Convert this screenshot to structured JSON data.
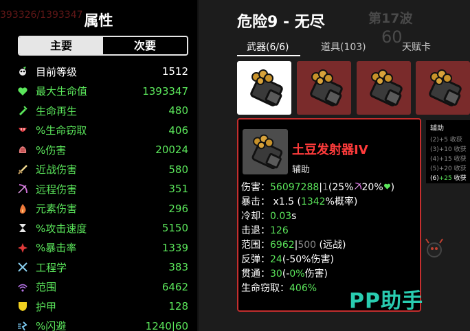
{
  "left": {
    "bg_ghost_text": "393326/1393347",
    "title": "属性",
    "tabs": {
      "primary": "主要",
      "secondary": "次要"
    },
    "stats": [
      {
        "icon": "level-icon",
        "label": "目前等级",
        "value": "1512",
        "label_color": "white"
      },
      {
        "icon": "heart-icon",
        "label": "最大生命值",
        "value": "1393347",
        "label_color": "green"
      },
      {
        "icon": "regen-icon",
        "label": "生命再生",
        "value": "480",
        "label_color": "green"
      },
      {
        "icon": "lifesteal-icon",
        "label": "%生命窃取",
        "value": "406",
        "label_color": "green"
      },
      {
        "icon": "damage-icon",
        "label": "%伤害",
        "value": "20024",
        "label_color": "green"
      },
      {
        "icon": "sword-icon",
        "label": "近战伤害",
        "value": "580",
        "label_color": "green"
      },
      {
        "icon": "bow-icon",
        "label": "远程伤害",
        "value": "351",
        "label_color": "green"
      },
      {
        "icon": "flame-icon",
        "label": "元素伤害",
        "value": "296",
        "label_color": "green"
      },
      {
        "icon": "hourglass-icon",
        "label": "%攻击速度",
        "value": "5150",
        "label_color": "green"
      },
      {
        "icon": "crit-icon",
        "label": "%暴击率",
        "value": "1339",
        "label_color": "green"
      },
      {
        "icon": "wrench-icon",
        "label": "工程学",
        "value": "383",
        "label_color": "green"
      },
      {
        "icon": "range-icon",
        "label": "范围",
        "value": "6462",
        "label_color": "green"
      },
      {
        "icon": "shield-icon",
        "label": "护甲",
        "value": "128",
        "label_color": "green"
      },
      {
        "icon": "dodge-icon",
        "label": "%闪避",
        "value": "1240|60",
        "label_color": "green"
      }
    ]
  },
  "right": {
    "title": "危险9 - 无尽",
    "wave_ghost": "第17波",
    "count_ghost": "60",
    "tabs": {
      "weapons": "武器(6/6)",
      "items": "道具(103)",
      "talent": "天赋卡"
    },
    "detail": {
      "name": "土豆发射器IV",
      "type": "辅助",
      "lines": {
        "damage_label": "伤害：",
        "damage_value": "56097288",
        "damage_sep": "|",
        "damage_base": "1",
        "damage_open": "(",
        "damage_pct1": "25%",
        "damage_pct2": "20%",
        "damage_close": ")",
        "crit_label": "暴击：",
        "crit_mult": "x1.5",
        "crit_open": "(",
        "crit_chance": "1342",
        "crit_suffix": "%概率)",
        "cooldown_label": "冷却：",
        "cooldown_value": "0.03",
        "cooldown_unit": "s",
        "knockback_label": "击退：",
        "knockback_value": "126",
        "range_label": "范围：",
        "range_value": "6962",
        "range_sep": "|",
        "range_base": "500",
        "range_note": "(远战)",
        "bounce_label": "反弹：",
        "bounce_value": "24",
        "bounce_note": "(-50%伤害)",
        "pierce_label": "贯通：",
        "pierce_value": "30",
        "pierce_open": "(-",
        "pierce_pct": "0%",
        "pierce_note": "伤害)",
        "lifesteal_label": "生命窃取：",
        "lifesteal_value": "406%"
      }
    },
    "side_tip": {
      "title": "辅助",
      "lines": [
        {
          "prefix": "(2)",
          "bonus": "+5",
          "text": "收获",
          "active": false
        },
        {
          "prefix": "(3)",
          "bonus": "+10",
          "text": "收获",
          "active": false
        },
        {
          "prefix": "(4)",
          "bonus": "+15",
          "text": "收获",
          "active": false
        },
        {
          "prefix": "(5)",
          "bonus": "+20",
          "text": "收获",
          "active": false
        },
        {
          "prefix": "(6)",
          "bonus": "+25",
          "text": "收获",
          "active": true
        }
      ]
    },
    "watermark": "PP助手"
  },
  "colors": {
    "stat_green": "#5be65b",
    "detail_border": "#c42e2e",
    "weapon_name": "#ff3b3b",
    "slot_bg": "#7a2b2b",
    "watermark": "#2ee3c4"
  }
}
